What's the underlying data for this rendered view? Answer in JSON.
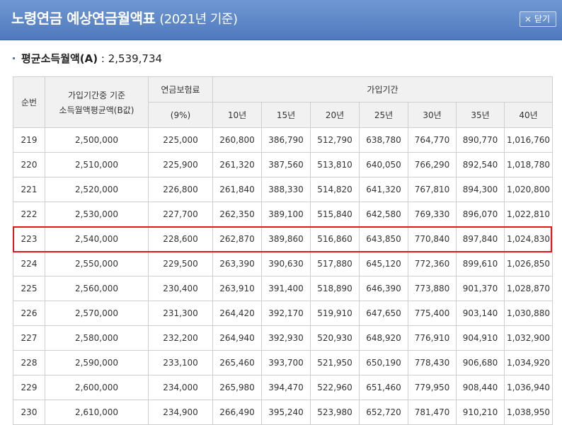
{
  "header": {
    "title_main": "노령연금 예상연금월액표",
    "title_sub": "(2021년 기준)",
    "close_label": "닫기",
    "close_icon": "×"
  },
  "summary": {
    "label": "평균소득월액(A)",
    "separator": " : ",
    "value": "2,539,734"
  },
  "table": {
    "headers": {
      "seq": "순번",
      "income_line1": "가입기간중 기준",
      "income_line2": "소득월액평균액(B값)",
      "premium": "연금보험료",
      "premium_rate": "(9%)",
      "period": "가입기간",
      "years": [
        "10년",
        "15년",
        "20년",
        "25년",
        "30년",
        "35년",
        "40년"
      ]
    },
    "rows": [
      [
        "219",
        "2,500,000",
        "225,000",
        "260,800",
        "386,790",
        "512,790",
        "638,780",
        "764,770",
        "890,770",
        "1,016,760"
      ],
      [
        "220",
        "2,510,000",
        "225,900",
        "261,320",
        "387,560",
        "513,810",
        "640,050",
        "766,290",
        "892,540",
        "1,018,780"
      ],
      [
        "221",
        "2,520,000",
        "226,800",
        "261,840",
        "388,330",
        "514,820",
        "641,320",
        "767,810",
        "894,300",
        "1,020,800"
      ],
      [
        "222",
        "2,530,000",
        "227,700",
        "262,350",
        "389,100",
        "515,840",
        "642,580",
        "769,330",
        "896,070",
        "1,022,810"
      ],
      [
        "223",
        "2,540,000",
        "228,600",
        "262,870",
        "389,860",
        "516,860",
        "643,850",
        "770,840",
        "897,840",
        "1,024,830"
      ],
      [
        "224",
        "2,550,000",
        "229,500",
        "263,390",
        "390,630",
        "517,880",
        "645,120",
        "772,360",
        "899,610",
        "1,026,850"
      ],
      [
        "225",
        "2,560,000",
        "230,400",
        "263,910",
        "391,400",
        "518,890",
        "646,390",
        "773,880",
        "901,370",
        "1,028,870"
      ],
      [
        "226",
        "2,570,000",
        "231,300",
        "264,420",
        "392,170",
        "519,910",
        "647,650",
        "775,400",
        "903,140",
        "1,030,880"
      ],
      [
        "227",
        "2,580,000",
        "232,200",
        "264,940",
        "392,930",
        "520,930",
        "648,920",
        "776,910",
        "904,910",
        "1,032,900"
      ],
      [
        "228",
        "2,590,000",
        "233,100",
        "265,460",
        "393,700",
        "521,950",
        "650,190",
        "778,430",
        "906,680",
        "1,034,920"
      ],
      [
        "229",
        "2,600,000",
        "234,000",
        "265,980",
        "394,470",
        "522,960",
        "651,460",
        "779,950",
        "908,440",
        "1,036,940"
      ],
      [
        "230",
        "2,610,000",
        "234,900",
        "266,490",
        "395,240",
        "523,980",
        "652,720",
        "781,470",
        "910,210",
        "1,038,950"
      ]
    ],
    "highlighted_row": "223"
  },
  "colors": {
    "header_bg": "#5a83c4",
    "highlight_border": "#e3161d",
    "table_header_bg": "#f1f1f1"
  }
}
